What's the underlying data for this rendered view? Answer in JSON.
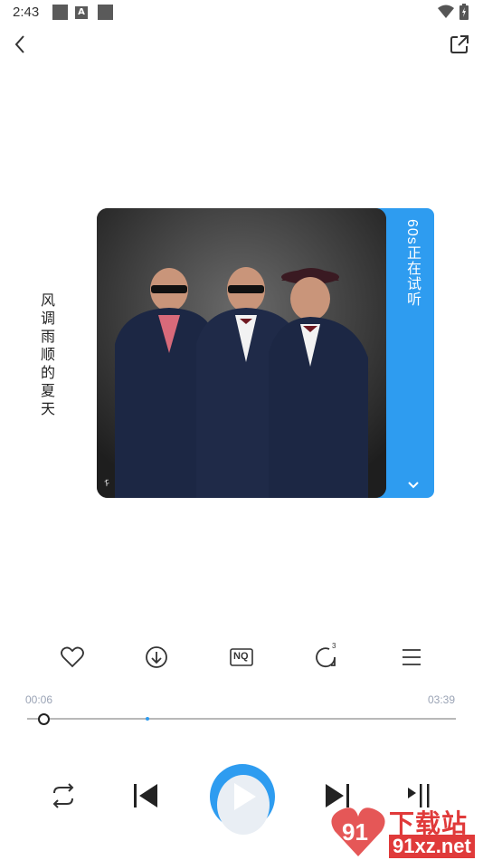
{
  "status_bar": {
    "time": "2:43",
    "a_label": "A"
  },
  "song": {
    "title": "风调雨顺的夏天"
  },
  "trial": {
    "label": "60s正在试听"
  },
  "progress": {
    "current": "00:06",
    "total": "03:39",
    "fraction": 0.027
  },
  "actions": {
    "quality_label": "NQ",
    "repeat_count": "3"
  },
  "watermark": {
    "top": "下载站",
    "bottom": "91xz.net"
  },
  "colors": {
    "accent": "#2e9cf0",
    "watermark": "#e03a3a"
  }
}
